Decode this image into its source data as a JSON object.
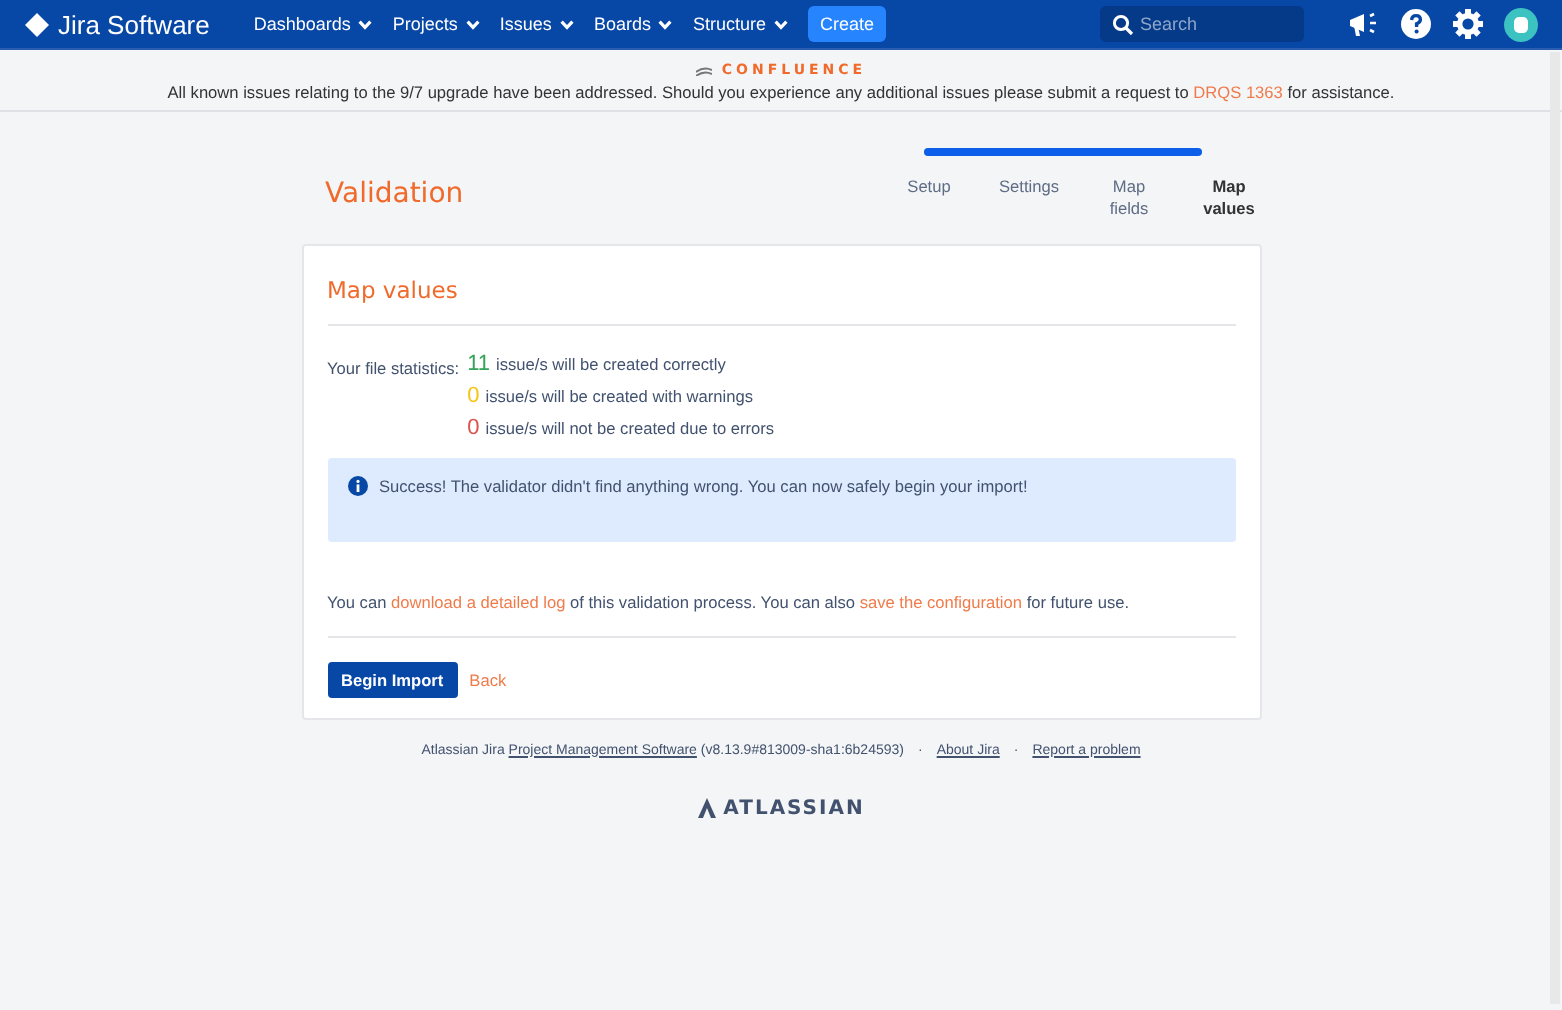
{
  "header": {
    "logo": "Jira Software",
    "nav": [
      {
        "label": "Dashboards"
      },
      {
        "label": "Projects"
      },
      {
        "label": "Issues"
      },
      {
        "label": "Boards"
      },
      {
        "label": "Structure"
      }
    ],
    "create": "Create",
    "search": {
      "placeholder": "Search"
    }
  },
  "announcement": {
    "source": "CONFLUENCE",
    "parts": [
      {
        "kind": "text",
        "text": "All known issues relating to the 9/7 upgrade have been addressed. Should you experience any additional issues please submit a request to "
      },
      {
        "kind": "link",
        "text": "DRQS 1363"
      },
      {
        "kind": "text",
        "text": " for assistance."
      }
    ]
  },
  "page_title": "Validation",
  "progress": {
    "level": 1
  },
  "steps": [
    {
      "label": "Setup",
      "selected": false
    },
    {
      "label": "Settings",
      "selected": false
    },
    {
      "label": "Map fields",
      "selected": false
    },
    {
      "label": "Map values",
      "selected": true
    }
  ],
  "card": {
    "title": "Map values",
    "stats_label": "Your file statistics:",
    "stats": [
      {
        "count": "11",
        "text": "issue/s will be created correctly",
        "color": "#36a35a"
      },
      {
        "count": "0",
        "text": "issue/s will be created with warnings",
        "color": "#f5c518"
      },
      {
        "count": "0",
        "text": "issue/s will not be created due to errors",
        "color": "#d9534f"
      }
    ],
    "message": "Success! The validator didn't find anything wrong. You can now safely begin your import!",
    "log_parts": [
      {
        "kind": "text",
        "text": "You can "
      },
      {
        "kind": "link",
        "text": "download a detailed log"
      },
      {
        "kind": "text",
        "text": " of this validation process. You can also "
      },
      {
        "kind": "link",
        "text": "save the configuration"
      },
      {
        "kind": "text",
        "text": " for future use."
      }
    ],
    "primary_button": "Begin Import",
    "back": "Back"
  },
  "footer": {
    "parts": [
      {
        "kind": "text",
        "text": "Atlassian Jira "
      },
      {
        "kind": "link",
        "text": "Project Management Software"
      },
      {
        "kind": "text",
        "text": " (v8.13.9#813009-sha1:6b24593)"
      }
    ],
    "links": [
      {
        "separator": "·",
        "label": "About Jira"
      },
      {
        "separator": "·",
        "label": "Report a problem"
      }
    ],
    "brand": "ATLASSIAN"
  }
}
